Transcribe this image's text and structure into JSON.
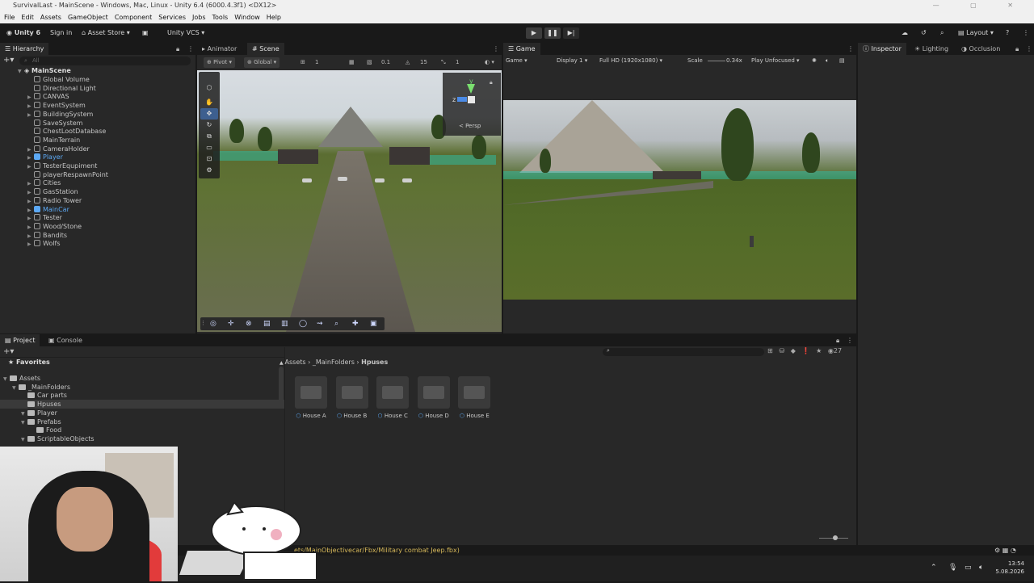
{
  "window": {
    "title": "SurvivalLast - MainScene - Windows, Mac, Linux - Unity 6.4 (6000.4.3f1) <DX12>"
  },
  "menu": [
    "File",
    "Edit",
    "Assets",
    "GameObject",
    "Component",
    "Services",
    "Jobs",
    "Tools",
    "Window",
    "Help"
  ],
  "toolbar": {
    "unity_label": "Unity 6",
    "signin": "Sign in",
    "asset_store": "Asset Store",
    "vcs": "Unity VCS",
    "layout": "Layout"
  },
  "hierarchy": {
    "tab": "Hierarchy",
    "search_placeholder": "All",
    "root": "MainScene",
    "items": [
      {
        "label": "Global Volume",
        "arrow": false
      },
      {
        "label": "Directional Light",
        "arrow": false
      },
      {
        "label": "CANVAS",
        "arrow": true
      },
      {
        "label": "EventSystem",
        "arrow": true
      },
      {
        "label": "BuildingSystem",
        "arrow": true
      },
      {
        "label": "SaveSystem",
        "arrow": false
      },
      {
        "label": "ChestLootDatabase",
        "arrow": false
      },
      {
        "label": "MainTerrain",
        "arrow": false
      },
      {
        "label": "CameraHolder",
        "arrow": true
      },
      {
        "label": "Player",
        "arrow": true,
        "highlight": true
      },
      {
        "label": "TesterEqupiment",
        "arrow": true
      },
      {
        "label": "playerRespawnPoint",
        "arrow": false
      },
      {
        "label": "Cities",
        "arrow": true
      },
      {
        "label": "GasStation",
        "arrow": true
      },
      {
        "label": "Radio Tower",
        "arrow": true
      },
      {
        "label": "MainCar",
        "arrow": true,
        "highlight": true
      },
      {
        "label": "Tester",
        "arrow": true
      },
      {
        "label": "Wood/Stone",
        "arrow": true
      },
      {
        "label": "Bandits",
        "arrow": true
      },
      {
        "label": "Wolfs",
        "arrow": true
      }
    ]
  },
  "scene": {
    "tab_animator": "Animator",
    "tab_scene": "Scene",
    "pivot": "Pivot",
    "global": "Global",
    "grid_val": "1",
    "snap_val": "0.1",
    "angle_val": "15",
    "scale_val": "1",
    "persp": "< Persp",
    "gizmo_y": "y",
    "gizmo_z": "z"
  },
  "game": {
    "tab": "Game",
    "mode": "Game",
    "display": "Display 1",
    "resolution": "Full HD (1920x1080)",
    "scale_label": "Scale",
    "scale_value": "0.34x",
    "play_mode": "Play Unfocused"
  },
  "inspector": {
    "tabs": [
      "Inspector",
      "Lighting",
      "Occlusion"
    ]
  },
  "project": {
    "tab_project": "Project",
    "tab_console": "Console",
    "favorites": "Favorites",
    "tree": [
      {
        "label": "Assets",
        "level": 0,
        "arrow": true
      },
      {
        "label": "_MainFolders",
        "level": 1,
        "arrow": true
      },
      {
        "label": "Car parts",
        "level": 2,
        "arrow": false
      },
      {
        "label": "Hpuses",
        "level": 2,
        "arrow": false,
        "selected": true
      },
      {
        "label": "Player",
        "level": 2,
        "arrow": true
      },
      {
        "label": "Prefabs",
        "level": 2,
        "arrow": true
      },
      {
        "label": "Food",
        "level": 3,
        "arrow": false
      },
      {
        "label": "ScriptableObjects",
        "level": 2,
        "arrow": true
      }
    ],
    "breadcrumb": [
      "Assets",
      "_MainFolders",
      "Hpuses"
    ],
    "count": "27",
    "assets": [
      "House A",
      "House B",
      "House C",
      "House D",
      "House E"
    ]
  },
  "status": {
    "message": "ets/MainObjectivecar/Fbx/Military combat Jeep.fbx)"
  },
  "taskbar": {
    "time": "13:54",
    "date": "5.08.2026"
  },
  "colors": {
    "accent": "#4a8ae6",
    "highlight_text": "#5ca9f5",
    "panel": "#282828",
    "dark": "#191919"
  }
}
